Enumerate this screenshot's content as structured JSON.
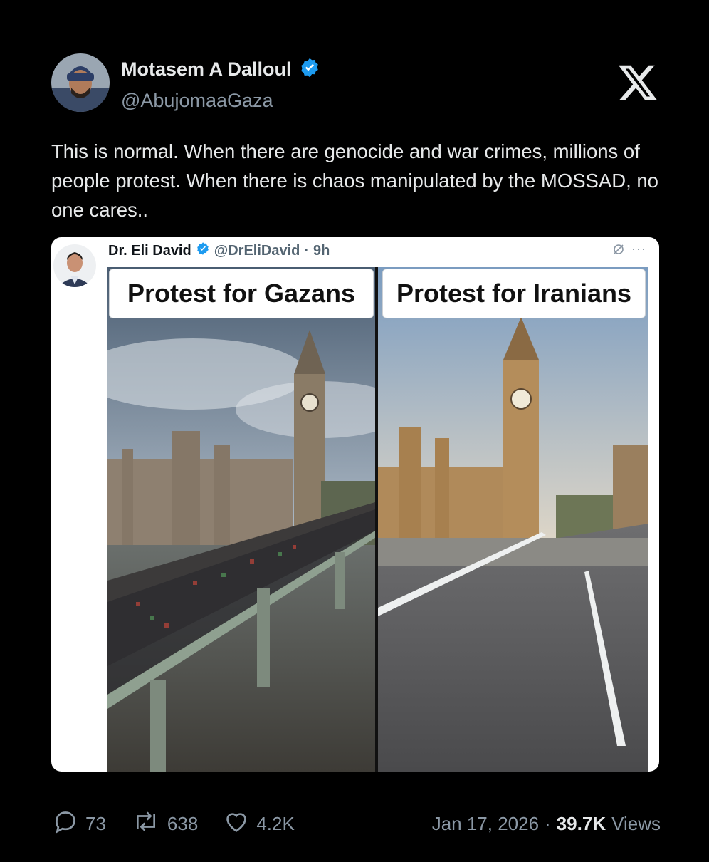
{
  "author": {
    "name": "Motasem A Dalloul",
    "handle": "@AbujomaaGaza",
    "verified": true
  },
  "tweet": {
    "text": "This is normal. When there are genocide and war crimes, millions of people protest. When there is chaos manipulated by the MOSSAD, no one cares.."
  },
  "quoted": {
    "name": "Dr. Eli David",
    "handle": "@DrEliDavid",
    "separator": "·",
    "time": "9h",
    "more": "···",
    "image": {
      "left_label": "Protest for Gazans",
      "right_label": "Protest for Iranians"
    }
  },
  "stats": {
    "replies": "73",
    "reposts": "638",
    "likes": "4.2K"
  },
  "meta": {
    "date": "Jan 17, 2026",
    "separator": "·",
    "views_count": "39.7K",
    "views_label": "Views"
  },
  "colors": {
    "background": "#000000",
    "verified_badge": "#1d9bf0",
    "text_primary": "#e7e9ea",
    "text_secondary": "#8b98a5"
  },
  "icons": {
    "logo": "x-logo-icon",
    "verified": "verified-badge-icon",
    "reply": "reply-icon",
    "repost": "repost-icon",
    "like": "heart-icon",
    "link": "link-icon"
  }
}
